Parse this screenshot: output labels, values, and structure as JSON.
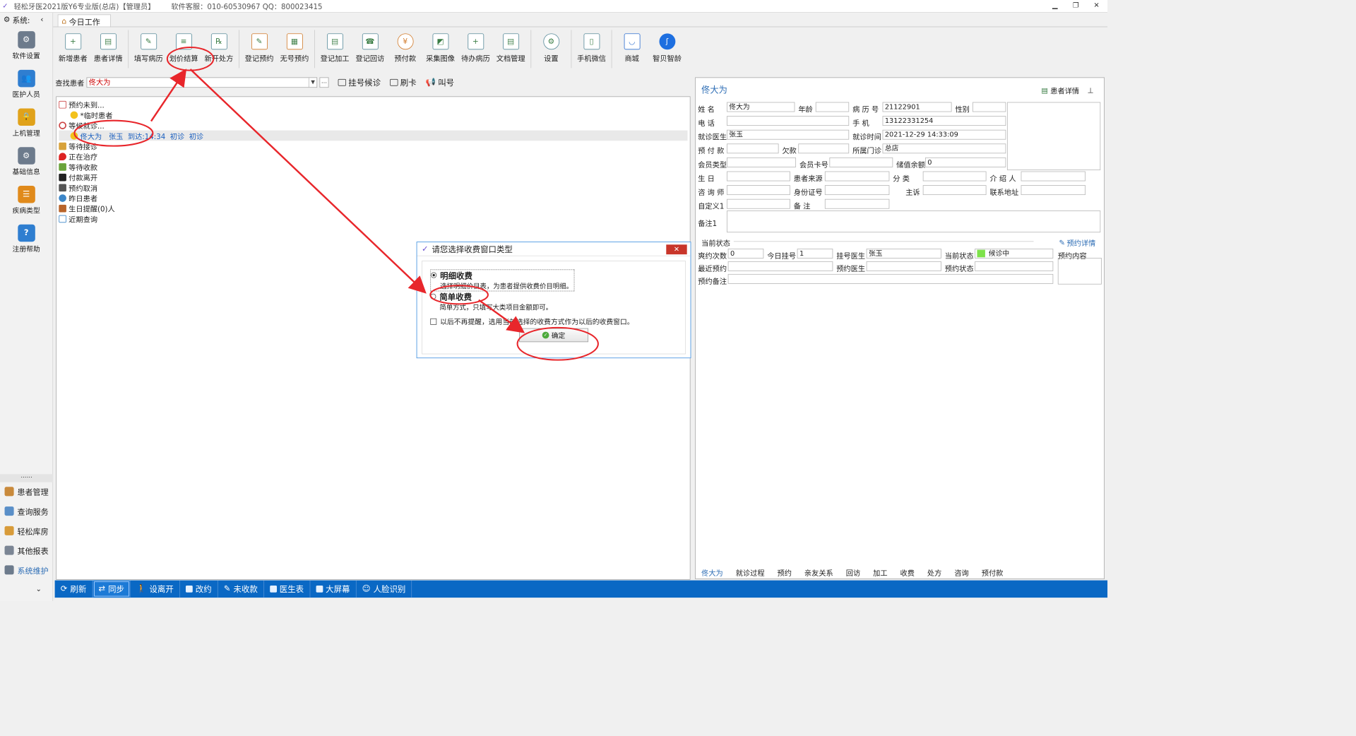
{
  "window": {
    "title": "轻松牙医2021版Y6专业版(总店)【管理员】",
    "service": "软件客服：010-60530967 QQ：800023415"
  },
  "sidebar": {
    "header": "系统:",
    "big_items": [
      {
        "label": "软件设置",
        "icon": "gear-icon",
        "color": "#6d7b8c"
      },
      {
        "label": "医护人员",
        "icon": "people-icon",
        "color": "#2f7ed0"
      },
      {
        "label": "上机管理",
        "icon": "lock-icon",
        "color": "#e0a21b"
      },
      {
        "label": "基础信息",
        "icon": "gear-icon",
        "color": "#6d7b8c"
      },
      {
        "label": "疾病类型",
        "icon": "tree-icon",
        "color": "#e08a1b"
      },
      {
        "label": "注册帮助",
        "icon": "help-icon",
        "color": "#2f7ed0"
      }
    ],
    "separator": "……",
    "small_items": [
      {
        "label": "患者管理",
        "active": false
      },
      {
        "label": "查询服务",
        "active": false
      },
      {
        "label": "轻松库房",
        "active": false
      },
      {
        "label": "其他报表",
        "active": false
      },
      {
        "label": "系统维护",
        "active": true
      }
    ]
  },
  "main_tab": "今日工作",
  "toolbar": {
    "buttons": [
      "新增患者",
      "患者详情",
      "填写病历",
      "划价结算",
      "新开处方",
      "登记预约",
      "无号预约",
      "登记加工",
      "登记回访",
      "预付款",
      "采集图像",
      "待办病历",
      "文档管理",
      "设置",
      "手机微信",
      "商城",
      "智贝智龄"
    ]
  },
  "search": {
    "label": "查找患者",
    "value": "佟大为",
    "queue_label": "挂号候诊",
    "swipe_label": "刷卡",
    "call_label": "叫号"
  },
  "tree": {
    "appointment_missing": "预约未到...",
    "temporary_patient": "*临时患者",
    "waiting": "等候就诊...",
    "waiting_row": {
      "name": "佟大为",
      "doctor": "张玉",
      "arrival": "到达:14:34",
      "type1": "初诊",
      "type2": "初诊"
    },
    "nodes": [
      "等待接诊",
      "正在治疗",
      "等待收款",
      "付款离开",
      "预约取消",
      "昨日患者",
      "生日提醒(0)人",
      "近期查询"
    ]
  },
  "patient": {
    "name_header": "佟大为",
    "detail_link": "患者详情",
    "labels": {
      "name": "姓  名",
      "age": "年龄",
      "record_no": "病 历 号",
      "gender": "性别",
      "phone": "电  话",
      "mobile": "手  机",
      "doctor": "就诊医生",
      "visit_time": "就诊时间",
      "prepay": "预 付 款",
      "owe": "欠款",
      "clinic": "所属门诊",
      "member_type": "会员类型",
      "member_card": "会员卡号",
      "balance": "储值余额",
      "birthday": "生  日",
      "source": "患者来源",
      "category": "分  类",
      "introducer": "介 绍 人",
      "consultant": "咨 询 师",
      "id_no": "身份证号",
      "complaint": "主诉",
      "address": "联系地址",
      "custom1": "自定义1",
      "remark": "备  注",
      "remark1": "备注1"
    },
    "values": {
      "name": "佟大为",
      "record_no": "21122901",
      "mobile": "13122331254",
      "doctor": "张玉",
      "visit_time": "2021-12-29 14:33:09",
      "clinic": "总店",
      "balance": "0"
    }
  },
  "status": {
    "title": "当前状态",
    "appt_detail": "预约详情",
    "labels": {
      "appt_count": "爽约次数",
      "today_reg": "今日挂号",
      "reg_doctor": "挂号医生",
      "current_status": "当前状态",
      "last_appt": "最近预约",
      "appt_doctor": "预约医生",
      "appt_status": "预约状态",
      "appt_remark": "预约备注",
      "appt_content": "预约内容"
    },
    "values": {
      "appt_count": "0",
      "today_reg": "1",
      "reg_doctor": "张玉",
      "current_status": "候诊中"
    },
    "status_color": "#7ee24a"
  },
  "bottom_tabs": [
    "佟大为",
    "就诊过程",
    "预约",
    "亲友关系",
    "回访",
    "加工",
    "收费",
    "处方",
    "咨询",
    "预付款"
  ],
  "modal": {
    "title": "请您选择收费窗口类型",
    "close": "✕",
    "option1_title": "明细收费",
    "option1_desc": "选择明细价目表，为患者提供收费价目明细。",
    "option2_title": "简单收费",
    "option2_desc": "简单方式，只填写大类项目金额即可。",
    "remember": "以后不再提醒，选用当前选择的收费方式作为以后的收费窗口。",
    "ok": "确定"
  },
  "statusbar": [
    {
      "label": "刷新",
      "active": false
    },
    {
      "label": "同步",
      "active": true
    },
    {
      "label": "设离开",
      "active": false
    },
    {
      "label": "改约",
      "active": false
    },
    {
      "label": "未收款",
      "active": false
    },
    {
      "label": "医生表",
      "active": false
    },
    {
      "label": "大屏幕",
      "active": false
    },
    {
      "label": "人脸识别",
      "active": false
    }
  ],
  "colors": {
    "accent": "#0a68c4",
    "annotation": "#e8262b",
    "link": "#2d6db5"
  }
}
